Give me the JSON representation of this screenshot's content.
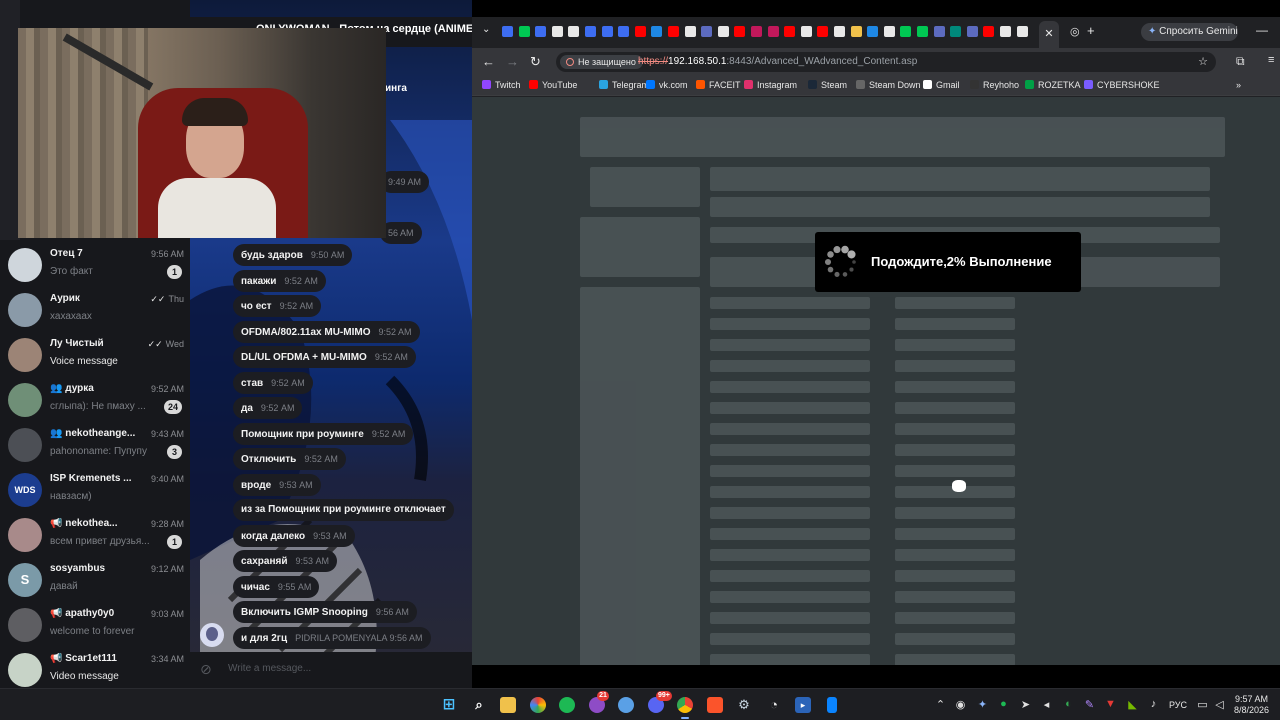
{
  "telegram": {
    "chat_title": "ONLYWOMAN - Потом на сердце (ANIMEE",
    "chat_subtitle": "инга",
    "input_placeholder": "Write a message...",
    "chats": [
      {
        "name": "Отец 7",
        "time": "9:56 AM",
        "preview": "Это факт",
        "badge": "1",
        "avatar_color": "#cfd6dc"
      },
      {
        "name": "Аурик",
        "time": "Thu",
        "preview": "хахахаах",
        "badge": "",
        "avatar_color": "#8a9aa8",
        "read": "✓✓"
      },
      {
        "name": "Лу Чистый",
        "time": "Wed",
        "preview": "Voice message",
        "badge": "",
        "avatar_color": "#9c8476",
        "read": "✓✓",
        "preview_white": true
      },
      {
        "name": "дурка",
        "time": "9:52 AM",
        "preview": "сглыпа): Не пмаху ...",
        "badge": "24",
        "avatar_color": "#6f8f77",
        "group": "👥"
      },
      {
        "name": "nekotheange...",
        "time": "9:43 AM",
        "preview": "pahononame: Пупупу",
        "badge": "3",
        "avatar_color": "#4c4f55",
        "group": "👥"
      },
      {
        "name": "ISP Kremenets ...",
        "time": "9:40 AM",
        "preview": "навзасм)",
        "badge": "",
        "avatar_color": "#1c3d8f",
        "avatar_text": "WDS"
      },
      {
        "name": "nekothea...",
        "time": "9:28 AM",
        "preview": "всем привет друзья...",
        "badge": "1",
        "avatar_color": "#a88a8a",
        "group": "📢"
      },
      {
        "name": "sosyambus",
        "time": "9:12 AM",
        "preview": "давай",
        "badge": "",
        "avatar_color": "#7b9aa8",
        "avatar_text": "S"
      },
      {
        "name": "apathy0y0",
        "time": "9:03 AM",
        "preview": "welcome to forever",
        "badge": "",
        "avatar_color": "#5e5e62",
        "group": "📢"
      },
      {
        "name": "Scar1et111",
        "time": "3:34 AM",
        "preview": "Video message",
        "badge": "",
        "avatar_color": "#c7d3c7",
        "group": "📢",
        "preview_white": true
      }
    ],
    "messages": [
      {
        "text": "будь здаров",
        "time": "9:50 AM"
      },
      {
        "text": "пакажи",
        "time": "9:52 AM"
      },
      {
        "text": "чо ест",
        "time": "9:52 AM"
      },
      {
        "text": "OFDMA/802.11ax MU-MIMO",
        "time": "9:52 AM"
      },
      {
        "text": "DL/UL OFDMA + MU-MIMO",
        "time": "9:52 AM"
      },
      {
        "text": "став",
        "time": "9:52 AM"
      },
      {
        "text": "да",
        "time": "9:52 AM"
      },
      {
        "text": "Помощник при роуминге",
        "time": "9:52 AM"
      },
      {
        "text": "Отключить",
        "time": "9:52 AM"
      },
      {
        "text": "вроде",
        "time": "9:53 AM"
      },
      {
        "text": "из за Помощник при роуминге отключает",
        "time": ""
      },
      {
        "text": "когда далеко",
        "time": "9:53 AM"
      },
      {
        "text": "сахраняй",
        "time": "9:53 AM"
      },
      {
        "text": "чичас",
        "time": "9:55 AM"
      },
      {
        "text": "Включить IGMP Snooping",
        "time": "9:56 AM"
      },
      {
        "text": "и для 2гц",
        "time": "PIDRILA POMENYALA 9:56 AM"
      }
    ],
    "partial_times": [
      "9:49 AM",
      "56 AM"
    ]
  },
  "browser": {
    "gemini_label": "Спросить Gemini",
    "insecure_label": "Не защищено",
    "url_scheme": "https://",
    "url_host": "192.168.50.1",
    "url_path": ":8443/Advanced_WAdvanced_Content.asp",
    "bookmarks": [
      {
        "label": "Twitch",
        "color": "#9146ff"
      },
      {
        "label": "YouTube",
        "color": "#ff0000"
      },
      {
        "label": "Telegram",
        "color": "#2aa3df"
      },
      {
        "label": "vk.com",
        "color": "#0077ff"
      },
      {
        "label": "FACEIT",
        "color": "#ff5500"
      },
      {
        "label": "Instagram",
        "color": "#e1306c"
      },
      {
        "label": "Steam",
        "color": "#1b2838"
      },
      {
        "label": "Steam Down",
        "color": "#666666"
      },
      {
        "label": "Gmail",
        "color": "#ffffff"
      },
      {
        "label": "Reyhoho",
        "color": "#333333"
      },
      {
        "label": "ROZETKA",
        "color": "#00a046"
      },
      {
        "label": "CYBERSHOKE",
        "color": "#7a5cff"
      }
    ],
    "loading_text": "Подождите,2% Выполнение"
  },
  "taskbar": {
    "lang": "РУС",
    "time": "9:57 AM",
    "date": "8/8/2026",
    "badges": {
      "app1": "21",
      "discord": "99+"
    }
  }
}
